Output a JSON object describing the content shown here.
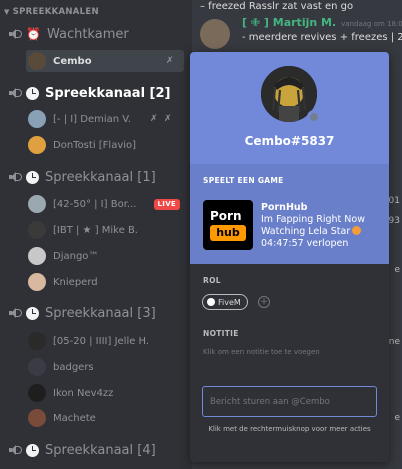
{
  "sidebar": {
    "category": "SPREEKKANALEN",
    "channels": [
      {
        "name": "Wachtkamer",
        "icon": "alarm-clock-icon"
      },
      {
        "name": "Spreekkanaal [2]",
        "icon": "clock-icon"
      },
      {
        "name": "Spreekkanaal [1]",
        "icon": "clock-icon"
      },
      {
        "name": "Spreekkanaal [3]",
        "icon": "clock-icon"
      },
      {
        "name": "Spreekkanaal [4]",
        "icon": "clock-icon"
      }
    ],
    "users": {
      "wachtkamer": [
        "Cembo"
      ],
      "kanaal2": [
        "[- | I] Demian V.",
        "DonTosti [Flavio]"
      ],
      "kanaal1": [
        "[42-50° | I] Bor...",
        "[IBT | ★ ] Mike B.",
        "Django™",
        "Knieperd"
      ],
      "kanaal3": [
        "[05-20 | IIII] Jelle H.",
        "badgers",
        "Ikon Nev4zz",
        "Machete"
      ]
    },
    "live_badge": "LIVE"
  },
  "chat": {
    "line_top": "– freezed Rasslr zat vast en go",
    "author": "[ ✙ ] Martijn M.",
    "time": "vandaag om 18:01",
    "message": "- meerdere revives + freezes | 2",
    "side_fragments": [
      "18:01",
      "093",
      "e",
      "ne",
      "e"
    ]
  },
  "popout": {
    "tag": "Cembo#5837",
    "game_header": "SPEELT EEN GAME",
    "game_icon_top": "Porn",
    "game_icon_bottom": "hub",
    "game_name": "PornHub",
    "game_line2": "Im Fapping Right Now",
    "game_line3": "Watching Lela Star",
    "game_elapsed": "04:47:57 verlopen",
    "roles_label": "ROL",
    "role": "FiveM",
    "role_add": "+",
    "notes_label": "NOTITIE",
    "notes_placeholder": "Klik om een notitie toe te voegen",
    "message_placeholder": "Bericht sturen aan @Cembo",
    "hint": "Klik met de rechtermuisknop voor meer acties"
  },
  "colors": {
    "blurple": "#7289da",
    "live_red": "#f04747",
    "online_green": "#43b581",
    "pornhub_orange": "#ff9900"
  }
}
